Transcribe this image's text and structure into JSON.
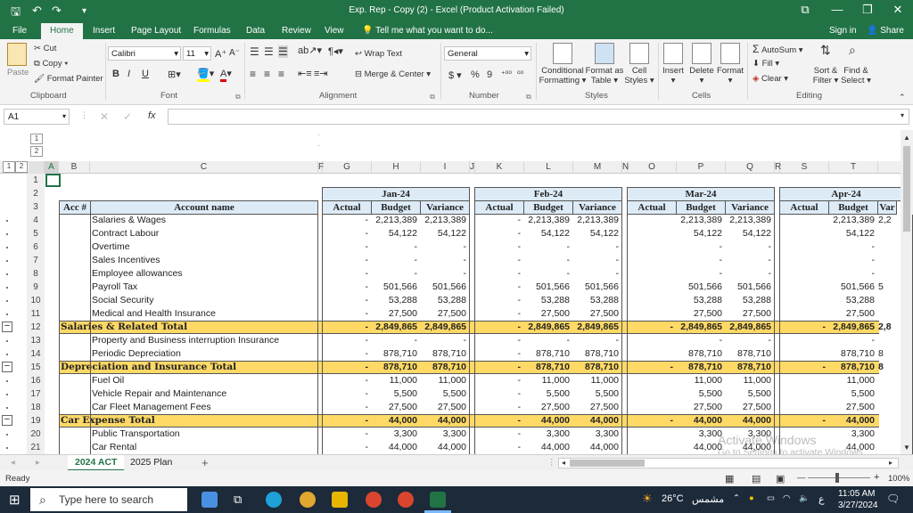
{
  "window": {
    "title": "Exp. Rep - Copy (2) - Excel (Product Activation Failed)",
    "min": "—",
    "restore": "❐",
    "close": "✕",
    "ribbon_display": "⧉"
  },
  "tabs": [
    "File",
    "Home",
    "Insert",
    "Page Layout",
    "Formulas",
    "Data",
    "Review",
    "View"
  ],
  "tell_me": "Tell me what you want to do...",
  "sign_in": "Sign in",
  "share": "Share",
  "ribbon": {
    "clipboard": {
      "label": "Clipboard",
      "paste": "Paste",
      "cut": "Cut",
      "copy": "Copy",
      "format_painter": "Format Painter"
    },
    "font": {
      "label": "Font",
      "name": "Calibri",
      "size": "11",
      "bold": "B",
      "italic": "I",
      "underline": "U"
    },
    "alignment": {
      "label": "Alignment",
      "wrap": "Wrap Text",
      "merge": "Merge & Center"
    },
    "number": {
      "label": "Number",
      "format": "General",
      "currency": "$",
      "percent": "%",
      "comma": "9"
    },
    "styles": {
      "label": "Styles",
      "conditional": "Conditional",
      "conditional2": "Formatting",
      "format_as": "Format as",
      "format_as2": "Table",
      "cell": "Cell",
      "cell2": "Styles"
    },
    "cells": {
      "label": "Cells",
      "insert": "Insert",
      "delete": "Delete",
      "format": "Format"
    },
    "editing": {
      "label": "Editing",
      "autosum": "AutoSum",
      "fill": "Fill",
      "clear": "Clear",
      "sort": "Sort &",
      "sort2": "Filter",
      "find": "Find &",
      "find2": "Select"
    }
  },
  "namebox": "A1",
  "fx": "fx",
  "outline_levels": [
    "1",
    "2"
  ],
  "columns": [
    "A",
    "B",
    "C",
    "F",
    "G",
    "H",
    "I",
    "J",
    "K",
    "L",
    "M",
    "N",
    "O",
    "P",
    "Q",
    "R",
    "S",
    "T"
  ],
  "months": [
    "Jan-24",
    "Feb-24",
    "Mar-24",
    "Apr-24"
  ],
  "subheads": {
    "actual": "Actual",
    "budget": "Budget",
    "variance": "Variance",
    "variance_short": "Var"
  },
  "table_head": {
    "acc": "Acc #",
    "name": "Account name"
  },
  "rows": [
    {
      "n": "1",
      "name": "",
      "total": false,
      "vals": []
    },
    {
      "n": "2",
      "name": "",
      "total": false,
      "vals": []
    },
    {
      "n": "3",
      "name": "",
      "total": false,
      "vals": []
    },
    {
      "n": "4",
      "name": "Salaries & Wages",
      "total": false,
      "vals": [
        "-",
        "2,213,389",
        "2,213,389",
        "-",
        "2,213,389",
        "2,213,389",
        "",
        "2,213,389",
        "2,213,389",
        "",
        "2,213,389",
        "2,2"
      ]
    },
    {
      "n": "5",
      "name": "Contract Labour",
      "total": false,
      "vals": [
        "-",
        "54,122",
        "54,122",
        "-",
        "54,122",
        "54,122",
        "",
        "54,122",
        "54,122",
        "",
        "54,122",
        ""
      ]
    },
    {
      "n": "6",
      "name": "Overtime",
      "total": false,
      "vals": [
        "-",
        "-",
        "-",
        "-",
        "-",
        "-",
        "",
        "-",
        "-",
        "",
        "-",
        ""
      ]
    },
    {
      "n": "7",
      "name": "Sales Incentives",
      "total": false,
      "vals": [
        "-",
        "-",
        "-",
        "-",
        "-",
        "-",
        "",
        "-",
        "-",
        "",
        "-",
        ""
      ]
    },
    {
      "n": "8",
      "name": "Employee allowances",
      "total": false,
      "vals": [
        "-",
        "-",
        "-",
        "-",
        "-",
        "-",
        "",
        "-",
        "-",
        "",
        "-",
        ""
      ]
    },
    {
      "n": "9",
      "name": "Payroll Tax",
      "total": false,
      "vals": [
        "-",
        "501,566",
        "501,566",
        "-",
        "501,566",
        "501,566",
        "",
        "501,566",
        "501,566",
        "",
        "501,566",
        "5"
      ]
    },
    {
      "n": "10",
      "name": "Social Security",
      "total": false,
      "vals": [
        "-",
        "53,288",
        "53,288",
        "-",
        "53,288",
        "53,288",
        "",
        "53,288",
        "53,288",
        "",
        "53,288",
        ""
      ]
    },
    {
      "n": "11",
      "name": "Medical and Health Insurance",
      "total": false,
      "vals": [
        "-",
        "27,500",
        "27,500",
        "-",
        "27,500",
        "27,500",
        "",
        "27,500",
        "27,500",
        "",
        "27,500",
        ""
      ]
    },
    {
      "n": "12",
      "name": "Salaries & Related Total",
      "total": true,
      "vals": [
        "-",
        "2,849,865",
        "2,849,865",
        "-",
        "2,849,865",
        "2,849,865",
        "-",
        "2,849,865",
        "2,849,865",
        "-",
        "2,849,865",
        "2,8"
      ]
    },
    {
      "n": "13",
      "name": "Property and Business interruption Insurance",
      "total": false,
      "vals": [
        "-",
        "-",
        "-",
        "-",
        "-",
        "-",
        "",
        "-",
        "-",
        "",
        "-",
        ""
      ]
    },
    {
      "n": "14",
      "name": "Periodic Depreciation",
      "total": false,
      "vals": [
        "-",
        "878,710",
        "878,710",
        "-",
        "878,710",
        "878,710",
        "",
        "878,710",
        "878,710",
        "",
        "878,710",
        "8"
      ]
    },
    {
      "n": "15",
      "name": "Depreciation and Insurance Total",
      "total": true,
      "vals": [
        "-",
        "878,710",
        "878,710",
        "-",
        "878,710",
        "878,710",
        "-",
        "878,710",
        "878,710",
        "-",
        "878,710",
        "8"
      ]
    },
    {
      "n": "16",
      "name": "Fuel Oil",
      "total": false,
      "vals": [
        "-",
        "11,000",
        "11,000",
        "-",
        "11,000",
        "11,000",
        "",
        "11,000",
        "11,000",
        "",
        "11,000",
        ""
      ]
    },
    {
      "n": "17",
      "name": "Vehicle Repair and Maintenance",
      "total": false,
      "vals": [
        "-",
        "5,500",
        "5,500",
        "-",
        "5,500",
        "5,500",
        "",
        "5,500",
        "5,500",
        "",
        "5,500",
        ""
      ]
    },
    {
      "n": "18",
      "name": "Car Fleet Management Fees",
      "total": false,
      "vals": [
        "-",
        "27,500",
        "27,500",
        "-",
        "27,500",
        "27,500",
        "",
        "27,500",
        "27,500",
        "",
        "27,500",
        ""
      ]
    },
    {
      "n": "19",
      "name": "Car Expense Total",
      "total": true,
      "vals": [
        "-",
        "44,000",
        "44,000",
        "-",
        "44,000",
        "44,000",
        "-",
        "44,000",
        "44,000",
        "-",
        "44,000",
        ""
      ]
    },
    {
      "n": "20",
      "name": "Public Transportation",
      "total": false,
      "vals": [
        "-",
        "3,300",
        "3,300",
        "-",
        "3,300",
        "3,300",
        "",
        "3,300",
        "3,300",
        "",
        "3,300",
        ""
      ]
    },
    {
      "n": "21",
      "name": "Car Rental",
      "total": false,
      "vals": [
        "-",
        "44,000",
        "44,000",
        "-",
        "44,000",
        "44,000",
        "",
        "44,000",
        "44,000",
        "",
        "44,000",
        ""
      ]
    }
  ],
  "sheet_tabs": [
    "2024 ACT",
    "2025 Plan"
  ],
  "add_sheet": "+",
  "status": {
    "ready": "Ready",
    "zoom": "100%"
  },
  "watermark": {
    "line1": "Activate Windows",
    "line2": "Go to Settings to activate Windows."
  },
  "taskbar": {
    "search": "Type here to search",
    "weather": "26°C",
    "weather_label": "مشمس",
    "time": "11:05 AM",
    "date": "3/27/2024",
    "lang": "ع"
  },
  "colors": {
    "excel_green": "#217346",
    "total_fill": "#ffd966",
    "header_fill": "#ddebf7"
  }
}
